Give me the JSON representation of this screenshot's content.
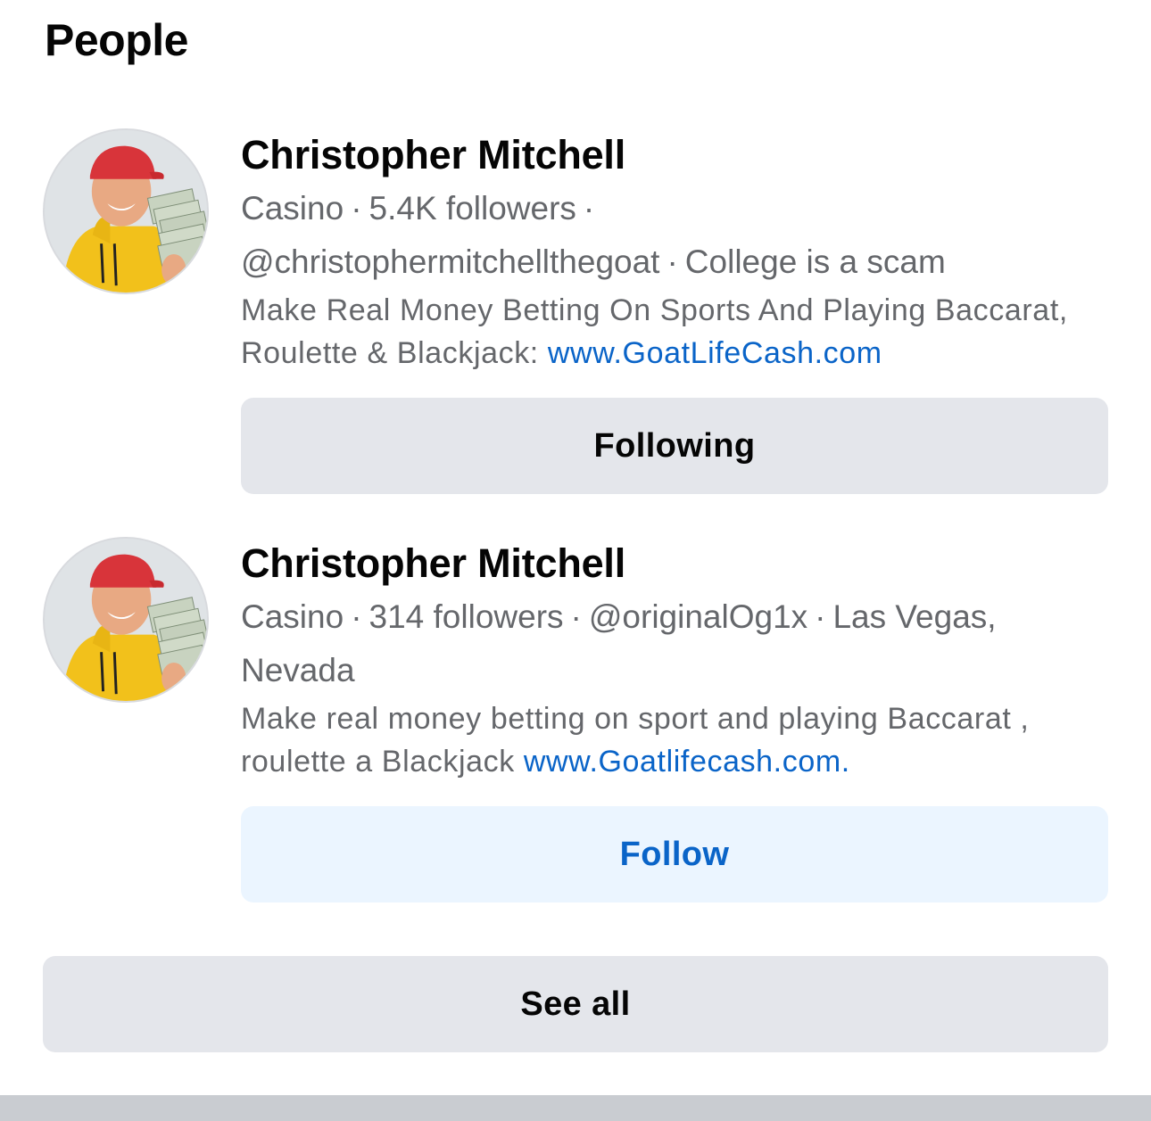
{
  "section": {
    "title": "People"
  },
  "results": [
    {
      "name": "Christopher Mitchell",
      "category": "Casino",
      "followers": "5.4K followers",
      "handle": "@christophermitchellthegoat",
      "extra": "College is a scam",
      "bio_text": "Make Real Money Betting On Sports And Playing Baccarat, Roulette & Blackjack: ",
      "bio_link": "www.GoatLifeCash.com",
      "button_label": "Following",
      "avatar_icon": "profile-photo"
    },
    {
      "name": "Christopher Mitchell",
      "category": "Casino",
      "followers": "314 followers",
      "handle": "@originalOg1x",
      "extra": "Las Vegas, Nevada",
      "bio_text": "Make real money betting on sport and playing Baccarat , roulette a Blackjack ",
      "bio_link": "www.Goatlifecash.com.",
      "button_label": "Follow",
      "avatar_icon": "profile-photo"
    }
  ],
  "see_all_label": "See all",
  "separator": "·",
  "colors": {
    "link": "#0a64c8",
    "secondary_text": "#65676b",
    "following_bg": "#e4e6eb",
    "follow_bg": "#ebf5ff"
  }
}
